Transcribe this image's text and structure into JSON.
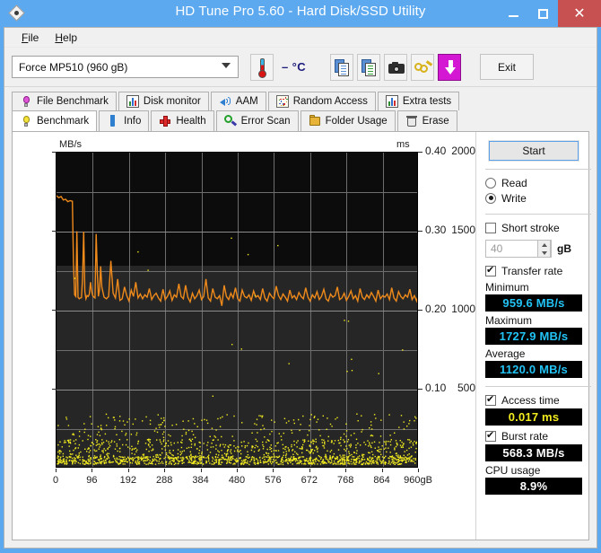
{
  "window": {
    "title": "HD Tune Pro 5.60 - Hard Disk/SSD Utility",
    "app_icon": "hdtune-diamond-icon",
    "minimize_label": "minimize",
    "maximize_label": "maximize",
    "close_label": "✕",
    "titlebar_color": "#5CA9F0",
    "close_color": "#c75050"
  },
  "menu": {
    "items": [
      {
        "label": "File",
        "accel": "F"
      },
      {
        "label": "Help",
        "accel": "H"
      }
    ]
  },
  "toolbar": {
    "device": {
      "value": "Force MP510 (960 gB)",
      "placeholder": "Select drive"
    },
    "temperature": "– °C",
    "temp_icon": "thermometer-icon",
    "buttons": [
      {
        "name": "copy-icon",
        "label": "Copy"
      },
      {
        "name": "copy-graph-icon",
        "label": "Copy graph"
      },
      {
        "name": "screenshot-icon",
        "label": "Screenshot"
      },
      {
        "name": "options-icon",
        "label": "Options"
      },
      {
        "name": "download-icon",
        "label": "Download"
      }
    ],
    "exit_label": "Exit"
  },
  "tabs": {
    "row_top": [
      {
        "label": "File Benchmark",
        "icon": "bulb-purple-icon",
        "active": false
      },
      {
        "label": "Disk monitor",
        "icon": "bar-chart-icon",
        "active": false
      },
      {
        "label": "AAM",
        "icon": "speaker-icon",
        "active": false
      },
      {
        "label": "Random Access",
        "icon": "random-dots-icon",
        "active": false
      },
      {
        "label": "Extra tests",
        "icon": "bar-chart-icon",
        "active": false
      }
    ],
    "row_bottom": [
      {
        "label": "Benchmark",
        "icon": "bulb-yellow-icon",
        "active": true
      },
      {
        "label": "Info",
        "icon": "info-icon",
        "active": false
      },
      {
        "label": "Health",
        "icon": "red-cross-icon",
        "active": false
      },
      {
        "label": "Error Scan",
        "icon": "magnifier-icon",
        "active": false
      },
      {
        "label": "Folder Usage",
        "icon": "folder-icon",
        "active": false
      },
      {
        "label": "Erase",
        "icon": "trash-icon",
        "active": false
      }
    ]
  },
  "sidebar": {
    "start_label": "Start",
    "mode": {
      "options": [
        {
          "label": "Read",
          "selected": false
        },
        {
          "label": "Write",
          "selected": true
        }
      ]
    },
    "short_stroke": {
      "label": "Short stroke",
      "checked": false,
      "value": "40",
      "unit": "gB"
    },
    "transfer_rate": {
      "label": "Transfer rate",
      "checked": true
    },
    "stats": [
      {
        "label": "Minimum",
        "value": "959.6 MB/s",
        "color": "cyan"
      },
      {
        "label": "Maximum",
        "value": "1727.9 MB/s",
        "color": "cyan"
      },
      {
        "label": "Average",
        "value": "1120.0 MB/s",
        "color": "cyan"
      }
    ],
    "access_time": {
      "label": "Access time",
      "checked": true,
      "value": "0.017 ms",
      "color": "yellow"
    },
    "burst_rate": {
      "label": "Burst rate",
      "checked": true,
      "value": "568.3 MB/s",
      "color": "white"
    },
    "cpu_usage": {
      "label": "CPU usage",
      "value": "8.9%",
      "color": "white"
    }
  },
  "chart_data": {
    "type": "line",
    "title": "",
    "xlabel": "",
    "ylabel": "MB/s",
    "y2label": "ms",
    "xlim": [
      0,
      960
    ],
    "ylim": [
      0,
      2000
    ],
    "y2lim": [
      0,
      0.4
    ],
    "grid": true,
    "background": "#1f1f1f",
    "xticks": [
      "0",
      "96",
      "192",
      "288",
      "384",
      "480",
      "576",
      "672",
      "768",
      "864",
      "960gB"
    ],
    "xtick_values": [
      0,
      96,
      192,
      288,
      384,
      480,
      576,
      672,
      768,
      864,
      960
    ],
    "yticks": [
      "2000",
      "1500",
      "1000",
      "500"
    ],
    "ytick_values": [
      2000,
      1500,
      1000,
      500
    ],
    "y2ticks": [
      "0.40",
      "0.30",
      "0.20",
      "0.10"
    ],
    "y2tick_values": [
      0.4,
      0.3,
      0.2,
      0.1
    ],
    "series": [
      {
        "name": "Transfer rate",
        "color": "#ef8a1b",
        "axis": "left",
        "unit": "MB/s",
        "x": [
          0,
          6,
          12,
          18,
          24,
          30,
          36,
          42,
          45,
          48,
          51,
          54,
          57,
          60,
          63,
          66,
          69,
          72,
          75,
          78,
          81,
          84,
          87,
          90,
          93,
          96,
          99,
          102,
          105,
          108,
          111,
          114,
          117,
          120,
          126,
          132,
          138,
          144,
          150,
          156,
          162,
          168,
          174,
          180,
          186,
          192,
          198,
          204,
          210,
          216,
          222,
          228,
          234,
          240,
          246,
          252,
          258,
          264,
          270,
          276,
          282,
          288,
          294,
          300,
          306,
          312,
          318,
          324,
          330,
          336,
          342,
          348,
          354,
          360,
          366,
          372,
          378,
          384,
          390,
          396,
          402,
          408,
          414,
          420,
          426,
          432,
          438,
          444,
          450,
          456,
          462,
          468,
          474,
          480,
          486,
          492,
          498,
          504,
          510,
          516,
          522,
          528,
          534,
          540,
          546,
          552,
          558,
          564,
          570,
          576,
          582,
          588,
          594,
          600,
          606,
          612,
          618,
          624,
          630,
          636,
          642,
          648,
          654,
          660,
          666,
          672,
          678,
          684,
          690,
          696,
          702,
          708,
          714,
          720,
          726,
          732,
          738,
          744,
          750,
          756,
          762,
          768,
          774,
          780,
          786,
          792,
          798,
          804,
          810,
          816,
          822,
          828,
          834,
          840,
          846,
          852,
          858,
          864,
          870,
          876,
          882,
          888,
          894,
          900,
          906,
          912,
          918,
          924,
          930,
          936,
          942,
          948,
          954,
          960
        ],
        "y": [
          1727,
          1715,
          1722,
          1700,
          1705,
          1690,
          1696,
          1692,
          1300,
          1100,
          1090,
          1502,
          1085,
          1075,
          1080,
          1082,
          1200,
          1500,
          1120,
          1075,
          1095,
          1090,
          1105,
          1180,
          1125,
          1095,
          1085,
          1080,
          1485,
          1240,
          1090,
          1135,
          1280,
          1150,
          1085,
          1075,
          1090,
          1315,
          1110,
          1080,
          1200,
          1065,
          1075,
          1150,
          1095,
          1060,
          1130,
          1090,
          1180,
          1080,
          1105,
          1075,
          1100,
          1085,
          1140,
          1070,
          1095,
          1110,
          1080,
          1060,
          1135,
          1070,
          1090,
          1125,
          1065,
          1100,
          1085,
          1170,
          1090,
          1075,
          1160,
          1085,
          1055,
          1110,
          1075,
          1095,
          1130,
          1070,
          1090,
          1200,
          1080,
          1060,
          1140,
          1085,
          1075,
          1095,
          1030,
          1160,
          1090,
          1070,
          1110,
          1080,
          1145,
          1075,
          1060,
          1130,
          1090,
          1080,
          1100,
          1065,
          1125,
          1085,
          1095,
          1070,
          1140,
          1080,
          1060,
          1110,
          1090,
          1075,
          1155,
          1095,
          1070,
          1105,
          1085,
          1060,
          1130,
          1080,
          1095,
          1070,
          1115,
          1090,
          1075,
          1145,
          1085,
          1060,
          1100,
          1080,
          1120,
          1070,
          1090,
          1135,
          1075,
          1060,
          1105,
          1085,
          1095,
          1150,
          1070,
          1080,
          1110,
          1065,
          1090,
          1125,
          1075,
          1095,
          1060,
          1140,
          1085,
          1070,
          1100,
          1080,
          1115,
          1090,
          1060,
          1130,
          1075,
          1095,
          1085,
          1105,
          1070,
          1145,
          1080,
          1060,
          1120,
          1090,
          1075,
          1100,
          1085,
          1135,
          1070,
          1095,
          1060,
          1110,
          1080,
          1090,
          1050,
          1040,
          1000
        ]
      },
      {
        "name": "Access time",
        "color": "#f2ec1f",
        "axis": "right",
        "unit": "ms",
        "note": "Scatter of per-sample access times, mostly 0.010-0.060 ms with occasional outliers to 0.30 ms",
        "typical_value": 0.017,
        "outlier_max": 0.3
      }
    ]
  }
}
